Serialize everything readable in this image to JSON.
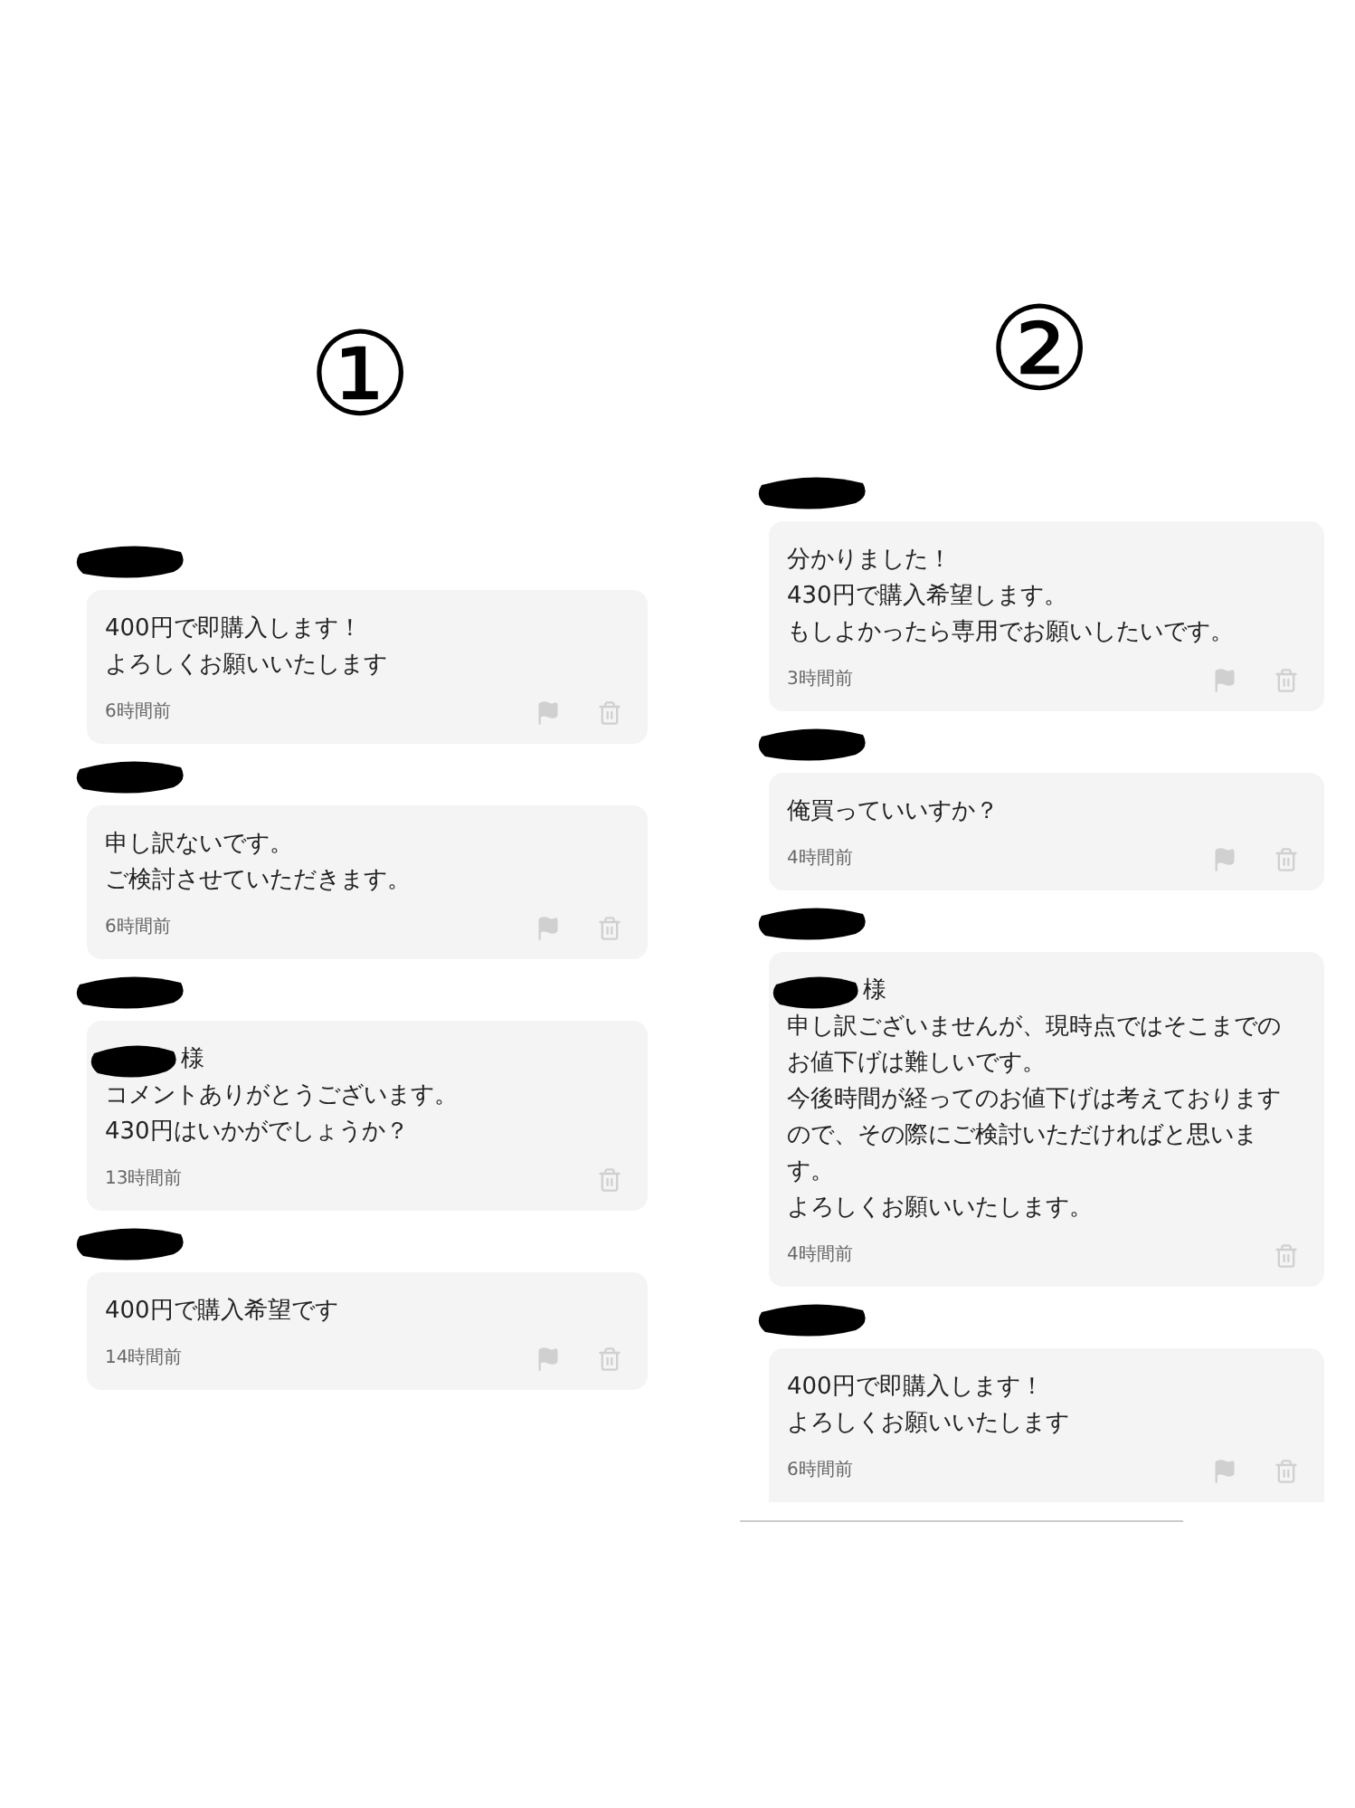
{
  "panels": [
    {
      "label": "①",
      "comments": [
        {
          "lines": [
            "400円で即購入します！",
            "よろしくお願いいたします"
          ],
          "time": "6時間前",
          "flag": true
        },
        {
          "lines": [
            "申し訳ないです。",
            "ご検討させていただきます。"
          ],
          "time": "6時間前",
          "flag": true
        },
        {
          "salutation": "様",
          "lines": [
            "コメントありがとうございます。",
            "430円はいかがでしょうか？"
          ],
          "time": "13時間前",
          "flag": false
        },
        {
          "lines": [
            "400円で購入希望です"
          ],
          "time": "14時間前",
          "flag": true
        }
      ]
    },
    {
      "label": "②",
      "comments": [
        {
          "lines": [
            "分かりました！",
            "430円で購入希望します。",
            "もしよかったら専用でお願いしたいです。"
          ],
          "time": "3時間前",
          "flag": true
        },
        {
          "lines": [
            "俺買っていいすか？"
          ],
          "time": "4時間前",
          "flag": true
        },
        {
          "salutation": "様",
          "lines": [
            "申し訳ございませんが、現時点ではそこまでの",
            "お値下げは難しいです。",
            "今後時間が経ってのお値下げは考えております",
            "ので、その際にご検討いただければと思いま",
            "す。",
            "よろしくお願いいたします。"
          ],
          "time": "4時間前",
          "flag": false
        },
        {
          "lines": [
            "400円で即購入します！",
            "よろしくお願いいたします"
          ],
          "time": "6時間前",
          "flag": true
        }
      ]
    }
  ]
}
